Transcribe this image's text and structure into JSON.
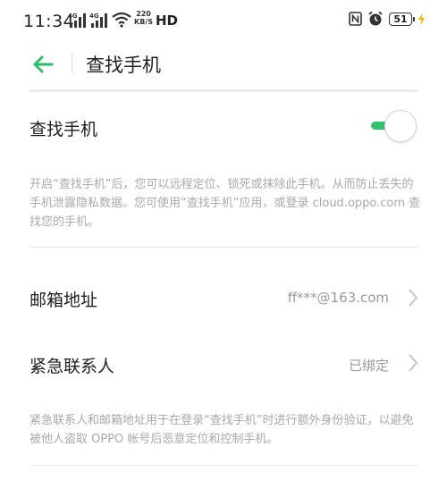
{
  "status_bar": {
    "time": "11:34",
    "signal1_tag": "4G",
    "signal2_tag": "4G",
    "speed_value": "220",
    "speed_unit": "KB/S",
    "hd": "HD",
    "battery": "51"
  },
  "header": {
    "title": "查找手机"
  },
  "find_phone": {
    "label": "查找手机",
    "enabled": true,
    "description": "开启“查找手机”后，您可以远程定位、锁死或抹除此手机。从而防止丢失的手机泄露隐私数据。您可使用“查找手机”应用，或登录 cloud.oppo.com 查找您的手机。"
  },
  "email_row": {
    "label": "邮箱地址",
    "value": "ff***@163.com"
  },
  "contact_row": {
    "label": "紧急联系人",
    "value": "已绑定"
  },
  "footer_desc": "紧急联系人和邮箱地址用于在登录“查找手机”时进行额外身份验证，以避免被他人盗取 OPPO 帐号后恶意定位和控制手机。",
  "colors": {
    "accent": "#31c26e",
    "back_arrow": "#2ebd6b"
  }
}
